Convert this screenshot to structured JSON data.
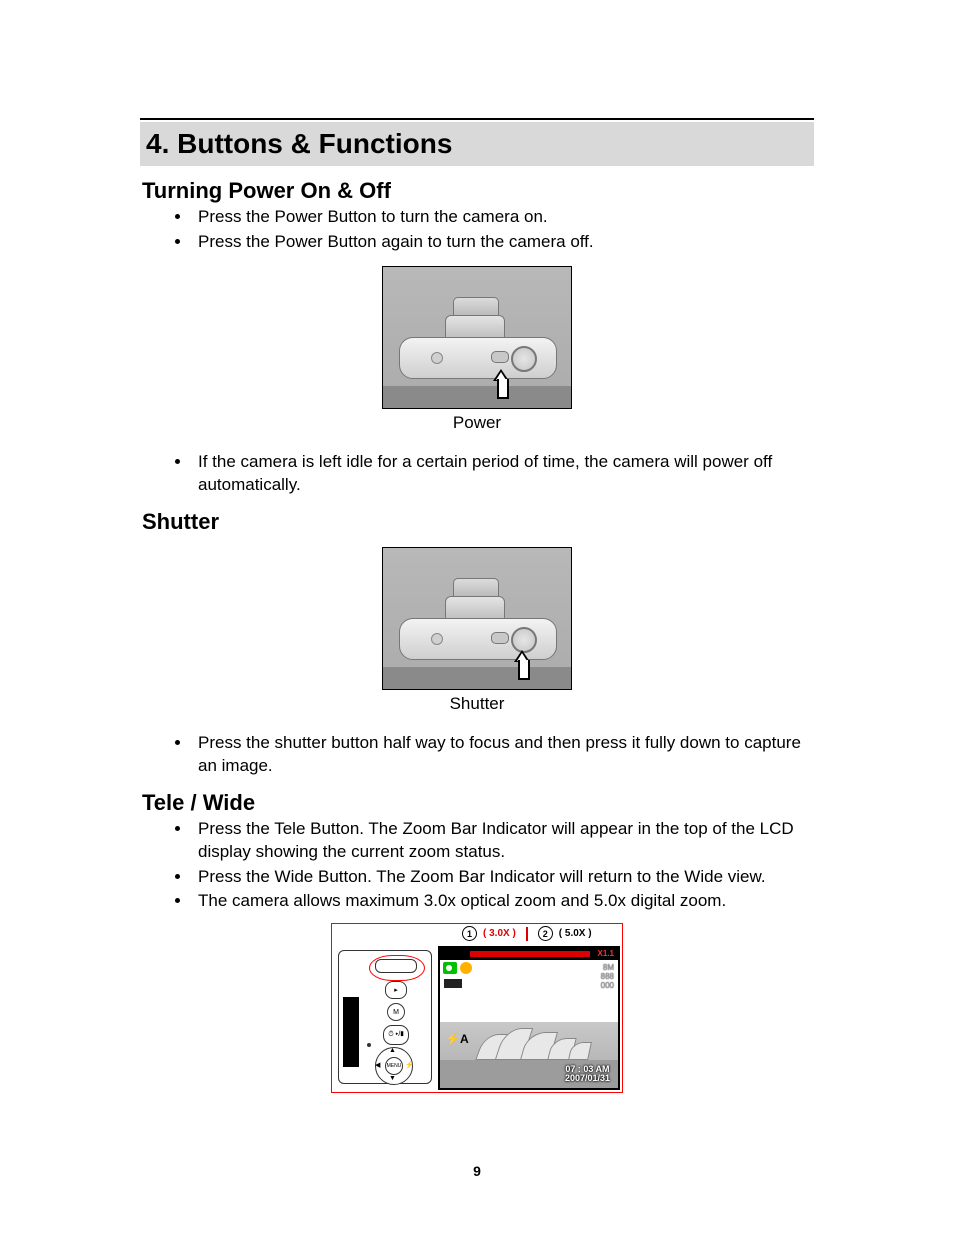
{
  "section": {
    "title": "4. Buttons & Functions"
  },
  "power": {
    "heading": "Turning Power On & Off",
    "bullets": [
      "Press the Power Button to turn the camera on.",
      "Press the Power Button again to turn the camera off."
    ],
    "figure_caption": "Power",
    "post_bullets": [
      "If the camera is left idle for a certain period of time, the camera will power off automatically."
    ]
  },
  "shutter": {
    "heading": "Shutter",
    "figure_caption": "Shutter",
    "bullets": [
      "Press the shutter button half way to focus and then press it fully down to capture an image."
    ]
  },
  "telewide": {
    "heading": "Tele / Wide",
    "bullets": [
      "Press the Tele Button. The Zoom Bar Indicator will appear in the top of the LCD display showing the current zoom status.",
      "Press the Wide Button. The Zoom Bar Indicator will return to the Wide view.",
      "The camera allows maximum 3.0x optical zoom and 5.0x digital zoom."
    ],
    "label1_num": "1",
    "label1_val": "( 3.0X )",
    "label2_num": "2",
    "label2_val": "( 5.0X )",
    "lcd": {
      "zoom_marker": "X1.1",
      "res": "8M",
      "shots": "888",
      "count2": "000",
      "flash": "⚡A",
      "time": "07 : 03 AM",
      "date": "2007/01/31",
      "back_label_m": "M",
      "back_label_menu": "MENU"
    }
  },
  "page_number": "9"
}
